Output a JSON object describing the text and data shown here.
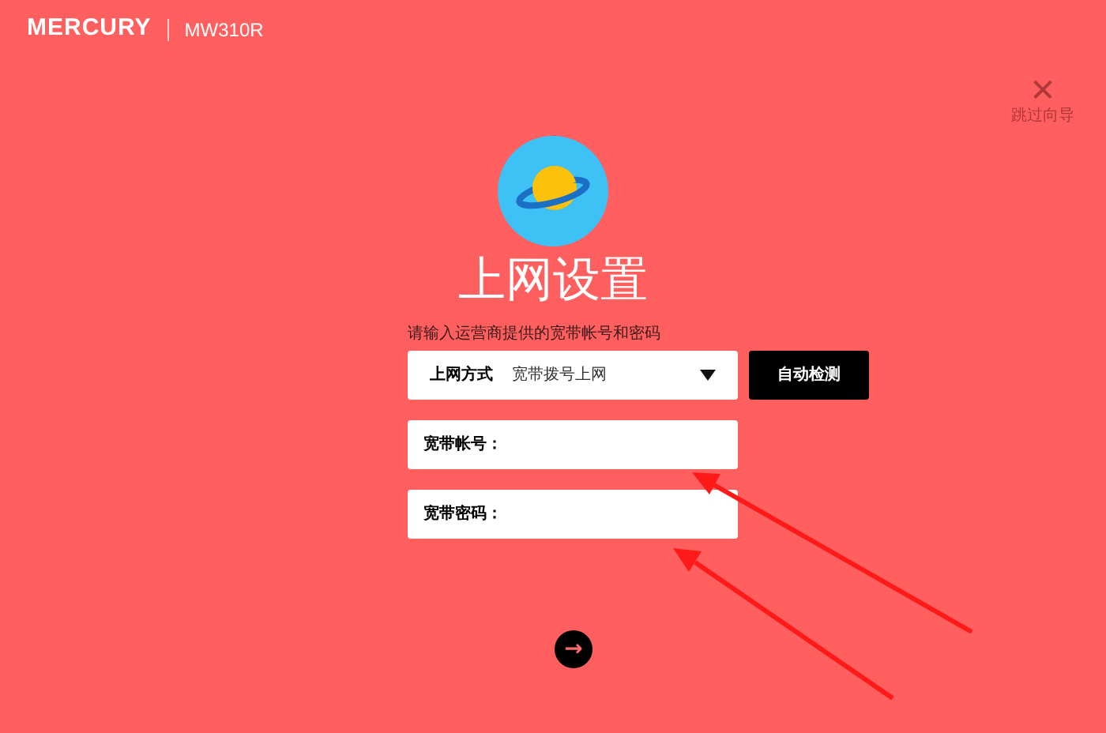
{
  "header": {
    "brand": "MERCURY",
    "model": "MW310R"
  },
  "skip": {
    "icon": "✕",
    "label": "跳过向导"
  },
  "title": "上网设置",
  "prompt": "请输入运营商提供的宽带帐号和密码",
  "connection": {
    "label": "上网方式",
    "value": "宽带拨号上网"
  },
  "auto_detect_button": "自动检测",
  "fields": [
    {
      "label": "宽带帐号："
    },
    {
      "label": "宽带密码："
    }
  ],
  "next_button": "→"
}
